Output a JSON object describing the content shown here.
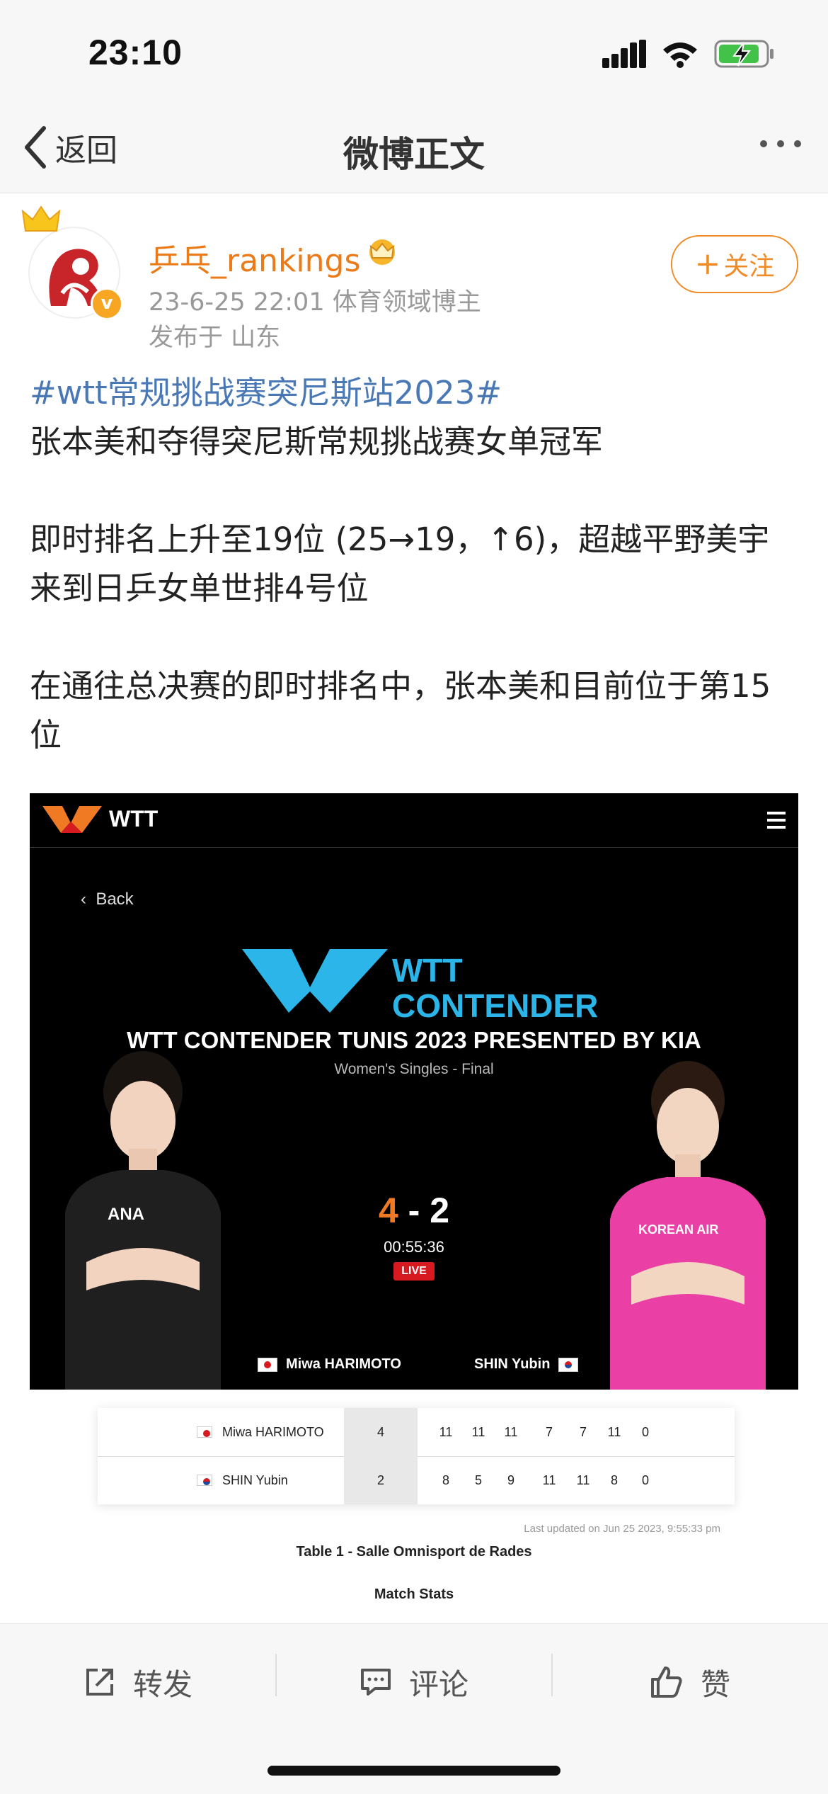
{
  "status_bar": {
    "time": "23:10"
  },
  "nav": {
    "back_label": "返回",
    "title": "微博正文"
  },
  "author": {
    "name": "乒乓_rankings",
    "meta": "23-6-25 22:01  体育领域博主",
    "location": "发布于 山东",
    "follow_label": "关注",
    "verify_mark": "v"
  },
  "post": {
    "hashtag": "#wtt常规挑战赛突尼斯站2023#",
    "line1": "张本美和夺得突尼斯常规挑战赛女单冠军",
    "paragraph2": "即时排名上升至19位 (25→19，↑6)，超越平野美宇来到日乒女单世排4号位",
    "paragraph3": "在通往总决赛的即时排名中，张本美和目前位于第15位"
  },
  "image": {
    "brand": "WTT",
    "back": "Back",
    "contender_line1": "WTT",
    "contender_line2": "CONTENDER",
    "event_title": "WTT CONTENDER TUNIS 2023 PRESENTED BY KIA",
    "event_subtitle": "Women's Singles - Final",
    "score_home": "4",
    "score_sep": " - ",
    "score_away": "2",
    "match_time": "00:55:36",
    "live": "LIVE",
    "player_left": "Miwa HARIMOTO",
    "player_right": "SHIN Yubin",
    "scoreboard": [
      {
        "name": "Miwa HARIMOTO",
        "total": "4",
        "games": [
          "11",
          "11",
          "11",
          "7",
          "7",
          "11",
          "0"
        ]
      },
      {
        "name": "SHIN Yubin",
        "total": "2",
        "games": [
          "8",
          "5",
          "9",
          "11",
          "11",
          "8",
          "0"
        ]
      }
    ],
    "last_updated": "Last updated on Jun 25 2023, 9:55:33 pm",
    "table_title": "Table 1 - Salle Omnisport de Rades",
    "match_stats": "Match Stats"
  },
  "actions": {
    "repost": "转发",
    "comment": "评论",
    "like": "赞"
  },
  "colors": {
    "author_name": "#eb7b19",
    "hashtag": "#4a78b5",
    "follow": "#f08c28",
    "contender": "#2bb5e8",
    "wtt_orange": "#f07a23"
  }
}
